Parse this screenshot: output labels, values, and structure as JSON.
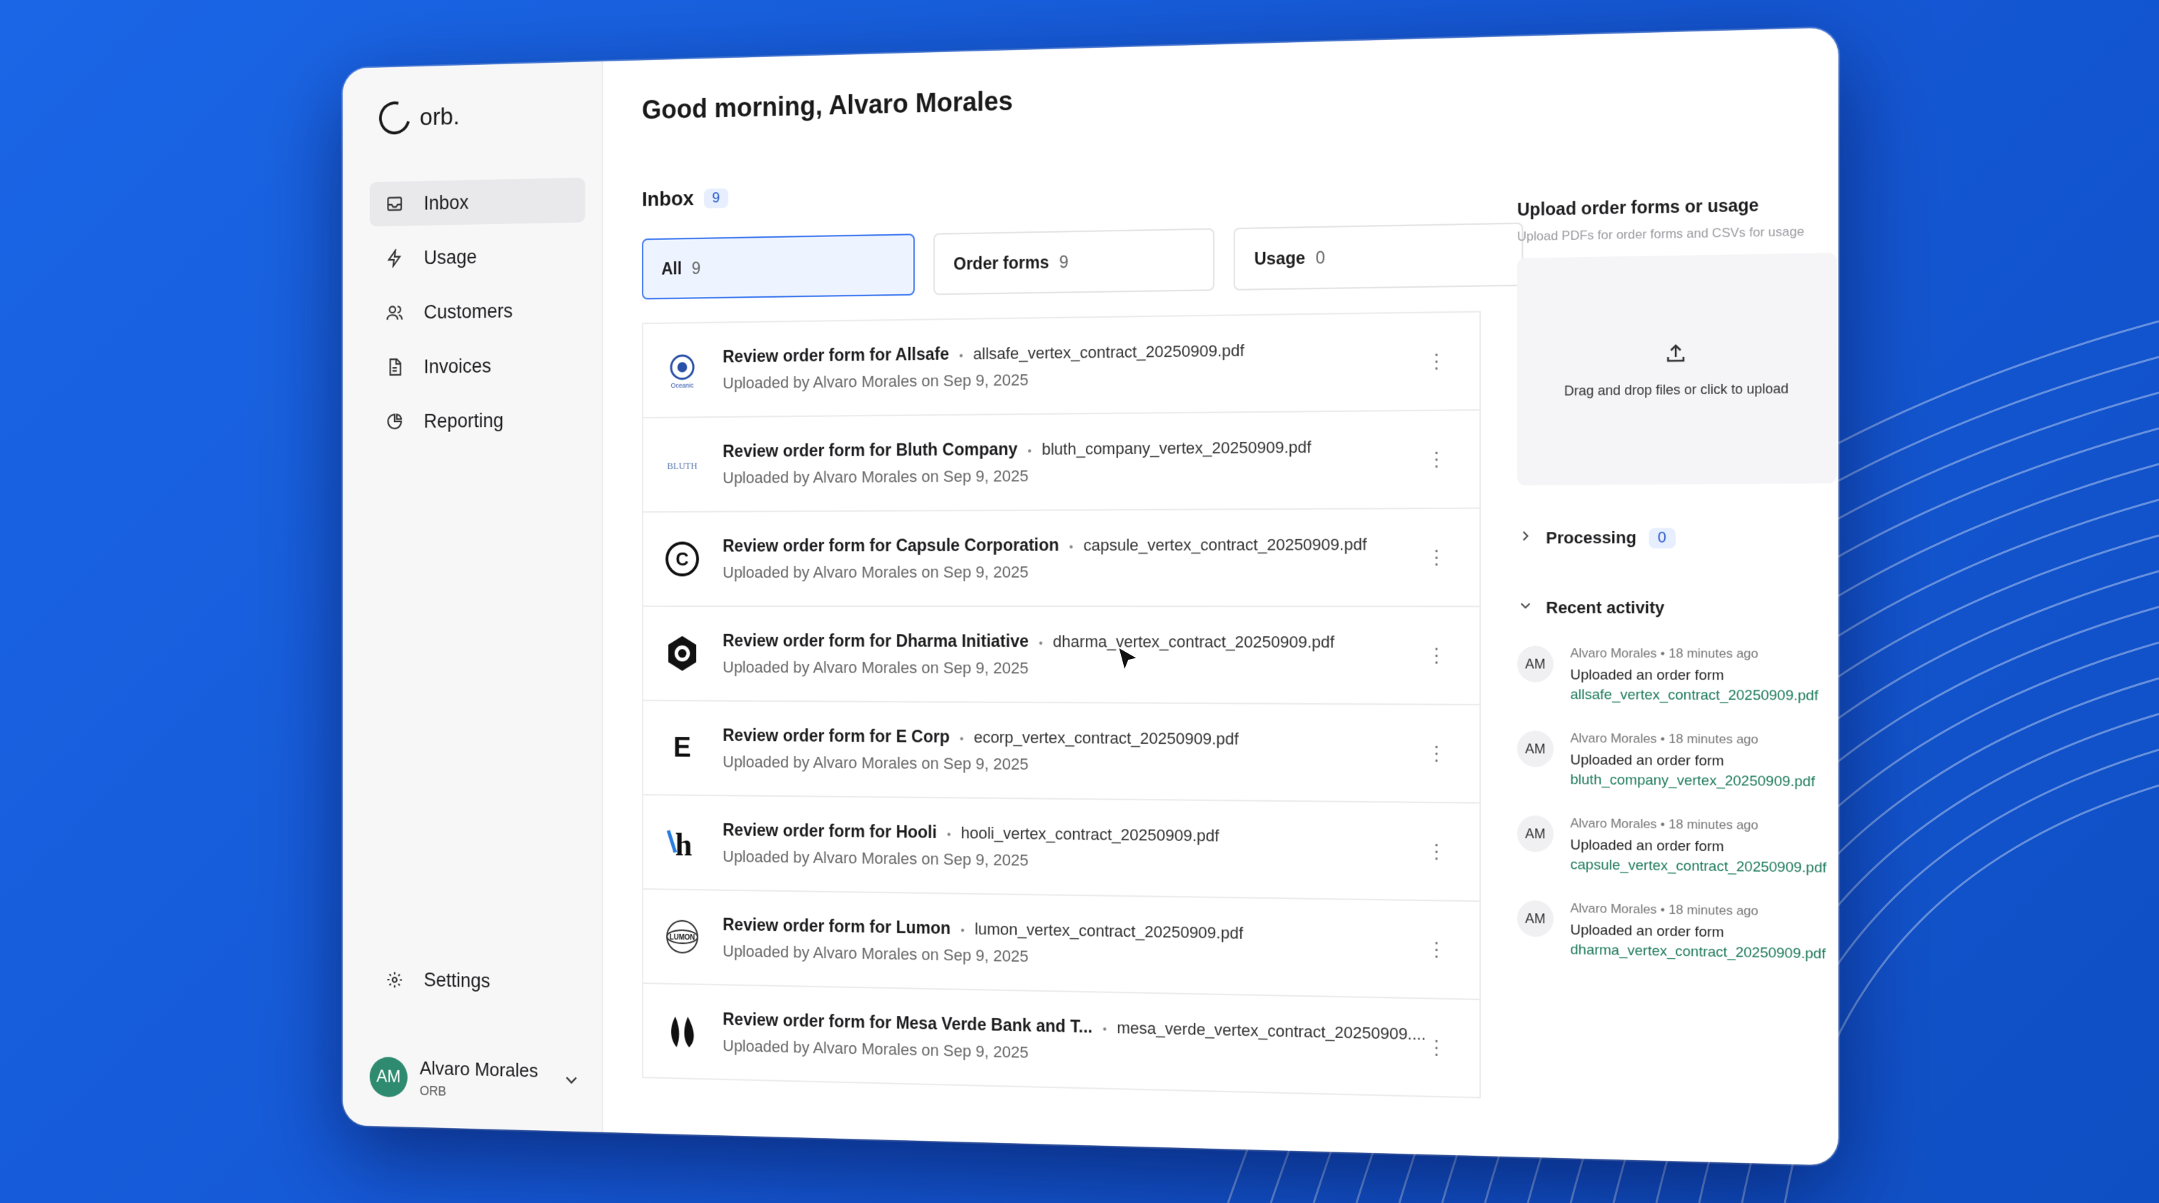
{
  "brand": {
    "name": "orb."
  },
  "sidebar": {
    "items": [
      {
        "label": "Inbox",
        "icon": "inbox-icon",
        "active": true
      },
      {
        "label": "Usage",
        "icon": "bolt-icon"
      },
      {
        "label": "Customers",
        "icon": "users-icon"
      },
      {
        "label": "Invoices",
        "icon": "document-icon"
      },
      {
        "label": "Reporting",
        "icon": "pie-chart-icon"
      }
    ],
    "settings_label": "Settings",
    "user": {
      "initials": "AM",
      "name": "Alvaro Morales",
      "org": "ORB"
    }
  },
  "main": {
    "greeting": "Good morning, Alvaro Morales",
    "inbox_label": "Inbox",
    "inbox_count": "9",
    "tabs": [
      {
        "label": "All",
        "count": "9"
      },
      {
        "label": "Order forms",
        "count": "9"
      },
      {
        "label": "Usage",
        "count": "0"
      }
    ],
    "rows": [
      {
        "title": "Review order form for Allsafe",
        "file": "allsafe_vertex_contract_20250909.pdf",
        "sub": "Uploaded by Alvaro Morales on Sep 9, 2025",
        "logo_text": "Oceanic"
      },
      {
        "title": "Review order form for Bluth Company",
        "file": "bluth_company_vertex_20250909.pdf",
        "sub": "Uploaded by Alvaro Morales on Sep 9, 2025",
        "logo_text": "BLUTH"
      },
      {
        "title": "Review order form for Capsule Corporation",
        "file": "capsule_vertex_contract_20250909.pdf",
        "sub": "Uploaded by Alvaro Morales on Sep 9, 2025",
        "logo_text": "C"
      },
      {
        "title": "Review order form for Dharma Initiative",
        "file": "dharma_vertex_contract_20250909.pdf",
        "sub": "Uploaded by Alvaro Morales on Sep 9, 2025",
        "logo_text": ""
      },
      {
        "title": "Review order form for E Corp",
        "file": "ecorp_vertex_contract_20250909.pdf",
        "sub": "Uploaded by Alvaro Morales on Sep 9, 2025",
        "logo_text": "E"
      },
      {
        "title": "Review order form for Hooli",
        "file": "hooli_vertex_contract_20250909.pdf",
        "sub": "Uploaded by Alvaro Morales on Sep 9, 2025",
        "logo_text": "h"
      },
      {
        "title": "Review order form for Lumon",
        "file": "lumon_vertex_contract_20250909.pdf",
        "sub": "Uploaded by Alvaro Morales on Sep 9, 2025",
        "logo_text": "LUMON"
      },
      {
        "title": "Review order form for Mesa Verde Bank and T...",
        "file": "mesa_verde_vertex_contract_20250909....",
        "sub": "Uploaded by Alvaro Morales on Sep 9, 2025",
        "logo_text": ""
      }
    ]
  },
  "right": {
    "upload_title": "Upload order forms or usage",
    "upload_subtitle": "Upload PDFs for order forms and CSVs for usage",
    "dropzone_text": "Drag and drop files or click to upload",
    "processing_label": "Processing",
    "processing_count": "0",
    "recent_label": "Recent activity",
    "activity": [
      {
        "initials": "AM",
        "who": "Alvaro Morales",
        "when": "18 minutes ago",
        "text": "Uploaded an order form",
        "file": "allsafe_vertex_contract_20250909.pdf"
      },
      {
        "initials": "AM",
        "who": "Alvaro Morales",
        "when": "18 minutes ago",
        "text": "Uploaded an order form",
        "file": "bluth_company_vertex_20250909.pdf"
      },
      {
        "initials": "AM",
        "who": "Alvaro Morales",
        "when": "18 minutes ago",
        "text": "Uploaded an order form",
        "file": "capsule_vertex_contract_20250909.pdf"
      },
      {
        "initials": "AM",
        "who": "Alvaro Morales",
        "when": "18 minutes ago",
        "text": "Uploaded an order form",
        "file": "dharma_vertex_contract_20250909.pdf"
      }
    ]
  },
  "colors": {
    "background": "#1a66e6",
    "accent": "#3d78f0",
    "avatar": "#2e8b6f",
    "link": "#1d7a5c"
  }
}
